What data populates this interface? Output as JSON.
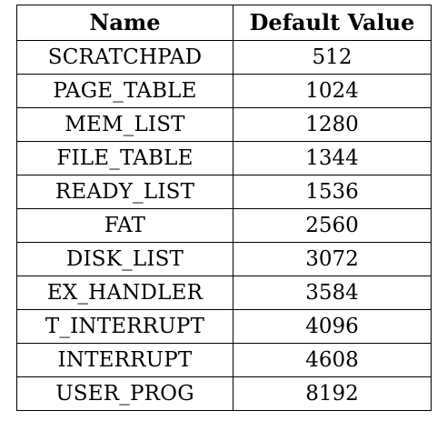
{
  "table": {
    "headers": {
      "name": "Name",
      "value": "Default Value"
    },
    "rows": [
      {
        "name": "SCRATCHPAD",
        "value": "512"
      },
      {
        "name": "PAGE_TABLE",
        "value": "1024"
      },
      {
        "name": "MEM_LIST",
        "value": "1280"
      },
      {
        "name": "FILE_TABLE",
        "value": "1344"
      },
      {
        "name": "READY_LIST",
        "value": "1536"
      },
      {
        "name": "FAT",
        "value": "2560"
      },
      {
        "name": "DISK_LIST",
        "value": "3072"
      },
      {
        "name": "EX_HANDLER",
        "value": "3584"
      },
      {
        "name": "T_INTERRUPT",
        "value": "4096"
      },
      {
        "name": "INTERRUPT",
        "value": "4608"
      },
      {
        "name": "USER_PROG",
        "value": "8192"
      }
    ]
  }
}
